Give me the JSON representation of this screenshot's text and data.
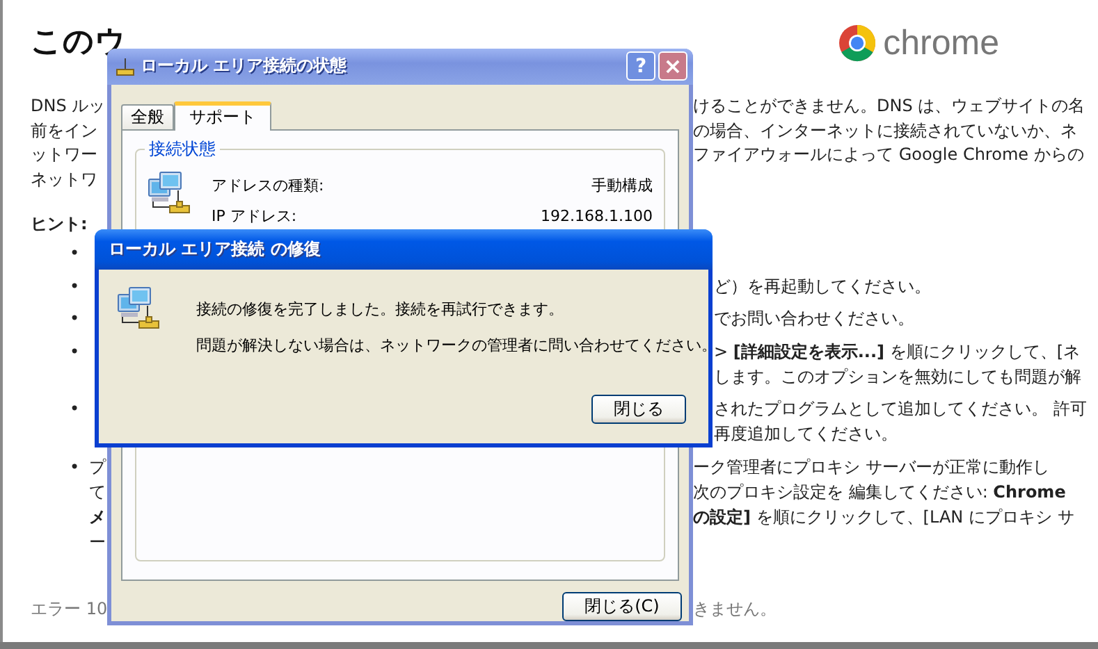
{
  "page": {
    "title": "このウ",
    "logo_text": "chrome",
    "paragraph_lines": [
      {
        "left": "DNS ルッ",
        "right": "けることができません。DNS は、ウェブサイトの名"
      },
      {
        "left": "前をイン",
        "right": "の場合、インターネットに接続されていないか、ネ"
      },
      {
        "left": "ットワー",
        "right": "ファイアウォールによって Google Chrome からの"
      },
      {
        "left": "ネットワ"
      }
    ],
    "hint_heading": "ヒント:",
    "hints": [
      {
        "bullet": "•"
      },
      {
        "bullet": "•",
        "lines": [
          {
            "right": "ど）を再起動してください。"
          }
        ]
      },
      {
        "bullet": "•",
        "lines": [
          {
            "right": "でお問い合わせください。"
          }
        ]
      },
      {
        "bullet": "•",
        "lines": [
          {
            "right": "> **[詳細設定を表示...]** を順にクリックして、[ネ"
          },
          {
            "right": "します。このオプションを無効にしても問題が解"
          }
        ]
      },
      {
        "bullet": "•",
        "lines": [
          {
            "right": "されたプログラムとして追加してください。 許可"
          },
          {
            "right": "再度追加してください。"
          }
        ]
      },
      {
        "bullet": "•",
        "lines": [
          {
            "left": "プ",
            "right": "ーク管理者にプロキシ サーバーが正常に動作し"
          },
          {
            "left": "て",
            "right": "次のプロキシ設定を 編集してください: **Chrome**"
          },
          {
            "left": "**メ**",
            "right": "**の設定]** を順にクリックして、[LAN にプロキシ サ"
          },
          {
            "left": "ー"
          }
        ]
      }
    ],
    "error_line": {
      "left": "エラー 10",
      "right": "きません。"
    }
  },
  "status_dialog": {
    "title": "ローカル エリア接続の状態",
    "help": "?",
    "close": "×",
    "tabs": [
      {
        "label": "全般",
        "selected": false
      },
      {
        "label": "サポート",
        "selected": true
      }
    ],
    "group_title": "接続状態",
    "fields": [
      {
        "label": "アドレスの種類:",
        "value": "手動構成"
      },
      {
        "label": "IP アドレス:",
        "value": "192.168.1.100"
      }
    ],
    "button": "閉じる(C)"
  },
  "repair_dialog": {
    "title": "ローカル エリア接続 の修復",
    "messages": [
      "接続の修復を完了しました。接続を再試行できます。",
      "問題が解決しない場合は、ネットワークの管理者に問い合わせてください。"
    ],
    "button": "閉じる"
  }
}
